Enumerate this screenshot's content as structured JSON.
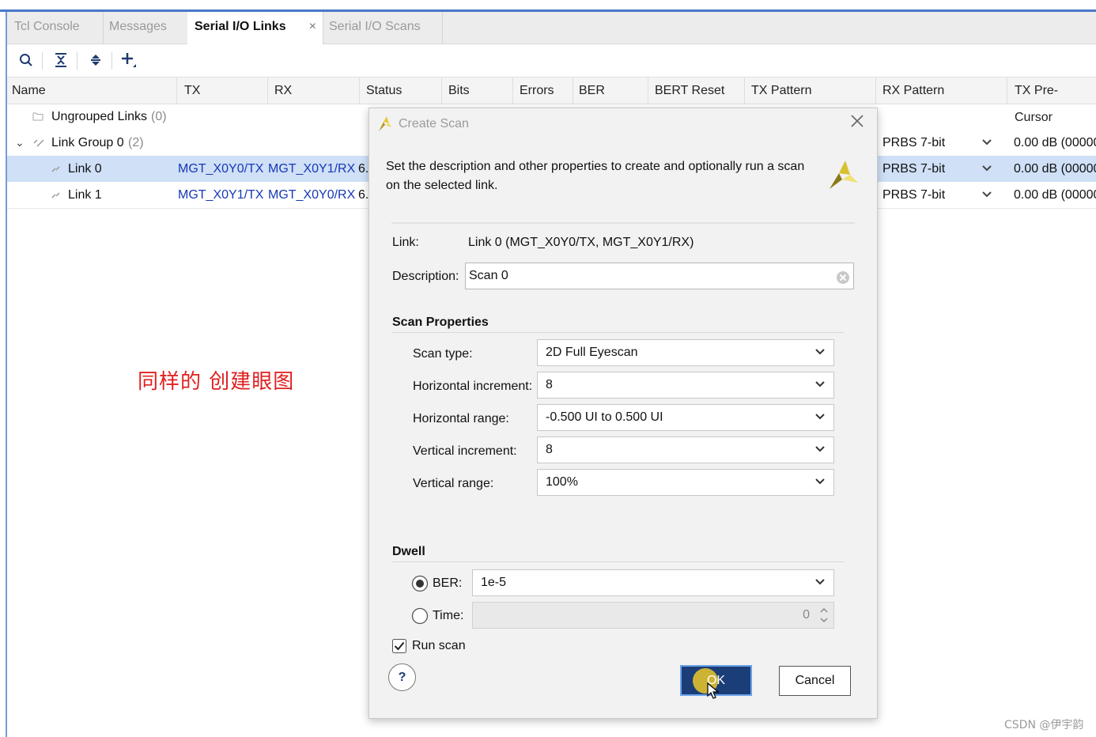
{
  "tabs": [
    {
      "label": "Tcl Console"
    },
    {
      "label": "Messages"
    },
    {
      "label": "Serial I/O Links",
      "close": "×"
    },
    {
      "label": "Serial I/O Scans"
    }
  ],
  "columns": [
    "Name",
    "TX",
    "RX",
    "Status",
    "Bits",
    "Errors",
    "BER",
    "BERT Reset",
    "TX Pattern",
    "RX Pattern",
    "TX Pre-Cursor"
  ],
  "rows": [
    {
      "name": "Ungrouped Links",
      "count": "(0)"
    },
    {
      "name": "Link Group 0",
      "count": "(2)",
      "rx_pattern": "PRBS 7-bit",
      "tx_precursor": "0.00 dB (00000"
    },
    {
      "name": "Link 0",
      "tx": "MGT_X0Y0/TX",
      "rx": "MGT_X0Y1/RX",
      "status": "6.",
      "rx_pattern": "PRBS 7-bit",
      "tx_precursor": "0.00 dB (00000"
    },
    {
      "name": "Link 1",
      "tx": "MGT_X0Y1/TX",
      "rx": "MGT_X0Y0/RX",
      "status": "6.",
      "rx_pattern": "PRBS 7-bit",
      "tx_precursor": "0.00 dB (00000"
    }
  ],
  "annotation": "同样的  创建眼图",
  "watermark": "CSDN @伊宇韵",
  "dialog": {
    "title": "Create Scan",
    "description_line1": "Set the description and other properties to create and optionally run a scan",
    "description_line2": "on the selected link.",
    "link_label": "Link:",
    "link_value": "Link 0 (MGT_X0Y0/TX, MGT_X0Y1/RX)",
    "desc_label": "Description:",
    "desc_value": "Scan 0",
    "scan_props_heading": "Scan Properties",
    "scan_type_label": "Scan type:",
    "scan_type_value": "2D Full Eyescan",
    "h_inc_label": "Horizontal increment:",
    "h_inc_value": "8",
    "h_range_label": "Horizontal range:",
    "h_range_value": "-0.500 UI to 0.500 UI",
    "v_inc_label": "Vertical increment:",
    "v_inc_value": "8",
    "v_range_label": "Vertical range:",
    "v_range_value": "100%",
    "dwell_heading": "Dwell",
    "ber_label": "BER:",
    "ber_value": "1e-5",
    "time_label": "Time:",
    "time_value": "0",
    "run_scan_label": "Run scan",
    "run_scan_checked": true,
    "help_label": "?",
    "ok_label": "OK",
    "cancel_label": "Cancel"
  },
  "colors": {
    "accent": "#4a78c8",
    "selection": "#cfe0f7",
    "link_text": "#1638b5",
    "annotation": "#e02020",
    "ok_button": "#1c3e78"
  }
}
